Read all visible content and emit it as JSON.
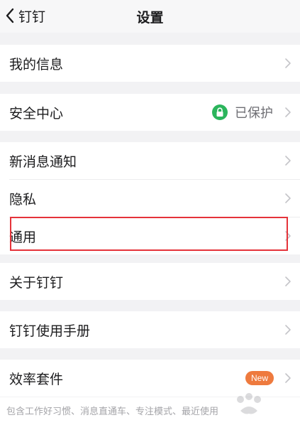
{
  "nav": {
    "back_label": "钉钉",
    "title": "设置"
  },
  "groups": [
    {
      "items": [
        {
          "label": "我的信息"
        }
      ]
    },
    {
      "items": [
        {
          "label": "安全中心",
          "status": "已保护"
        }
      ]
    },
    {
      "items": [
        {
          "label": "新消息通知"
        },
        {
          "label": "隐私"
        },
        {
          "label": "通用"
        }
      ]
    },
    {
      "items": [
        {
          "label": "关于钉钉"
        }
      ]
    },
    {
      "items": [
        {
          "label": "钉钉使用手册"
        }
      ]
    },
    {
      "items": [
        {
          "label": "效率套件",
          "badge": "New"
        }
      ]
    }
  ],
  "efficiency_description": "包含工作好习惯、消息直通车、专注模式、最近使用",
  "colors": {
    "background": "#f2f2f4",
    "lock_green": "#2bb55c",
    "badge_orange": "#ee7a3e",
    "highlight_red": "#e5333a"
  },
  "icons": [
    "back-chevron-icon",
    "chevron-right-icon",
    "lock-icon"
  ]
}
